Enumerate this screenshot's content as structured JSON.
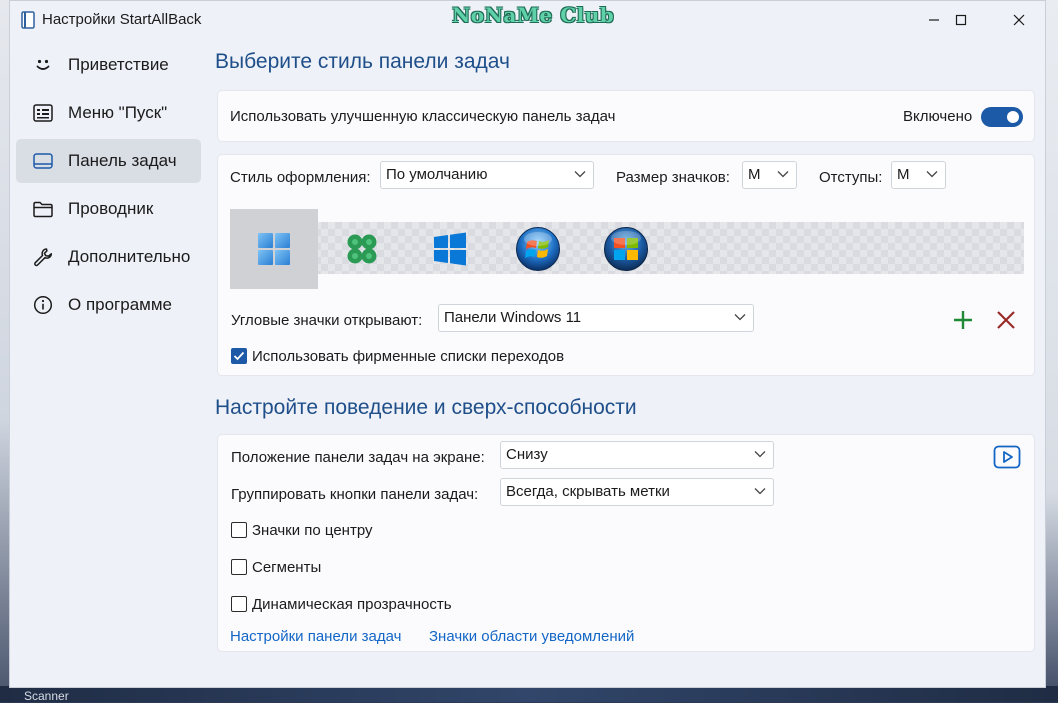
{
  "window": {
    "title": "Настройки StartAllBack",
    "watermark": "NoNaMe Club"
  },
  "desktop": {
    "bottom_label": "Scanner"
  },
  "colors": {
    "accent": "#1c5aa8",
    "heading": "#1f4f8a",
    "link": "#1466c6",
    "add": "#1e8a33",
    "remove": "#9a2a2a"
  },
  "sidebar": {
    "items": [
      {
        "label": "Приветствие",
        "icon": "smiley-icon",
        "active": false
      },
      {
        "label": "Меню \"Пуск\"",
        "icon": "start-menu-icon",
        "active": false
      },
      {
        "label": "Панель задач",
        "icon": "taskbar-icon",
        "active": true
      },
      {
        "label": "Проводник",
        "icon": "folder-icon",
        "active": false
      },
      {
        "label": "Дополнительно",
        "icon": "wrench-icon",
        "active": false
      },
      {
        "label": "О программе",
        "icon": "info-icon",
        "active": false
      }
    ]
  },
  "section1": {
    "title": "Выберите стиль панели задач",
    "enhanced": {
      "label": "Использовать улучшенную классическую панель задач",
      "state_label": "Включено",
      "on": true
    },
    "style": {
      "label": "Стиль оформления:",
      "value": "По умолчанию"
    },
    "icon_size": {
      "label": "Размер значков:",
      "value": "M"
    },
    "padding": {
      "label": "Отступы:",
      "value": "M"
    },
    "styles": [
      {
        "icon": "windows11-logo-icon",
        "selected": true
      },
      {
        "icon": "clover-logo-icon",
        "selected": false
      },
      {
        "icon": "windows10-logo-icon",
        "selected": false
      },
      {
        "icon": "windows7-orb-icon",
        "selected": false
      },
      {
        "icon": "vista-orb-icon",
        "selected": false
      }
    ],
    "corner": {
      "label": "Угловые значки открывают:",
      "value": "Панели Windows 11"
    },
    "jumplists": {
      "label": "Использовать фирменные списки переходов",
      "checked": true
    }
  },
  "section2": {
    "title": "Настройте поведение и сверх-способности",
    "position": {
      "label": "Положение панели задач на экране:",
      "value": "Снизу"
    },
    "grouping": {
      "label": "Группировать кнопки панели задач:",
      "value": "Всегда, скрывать метки"
    },
    "checkboxes": [
      {
        "label": "Значки по центру",
        "checked": false
      },
      {
        "label": "Сегменты",
        "checked": false
      },
      {
        "label": "Динамическая прозрачность",
        "checked": false
      }
    ],
    "links": [
      "Настройки панели задач",
      "Значки области уведомлений"
    ]
  }
}
